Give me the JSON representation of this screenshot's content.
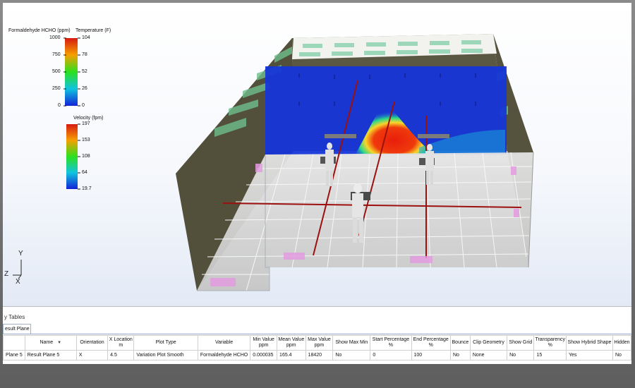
{
  "legends": {
    "formaldehyde": {
      "title": "Formaldehyde HCHO (ppm)",
      "ticks": [
        "1000",
        "750",
        "500",
        "250",
        "0"
      ]
    },
    "temperature": {
      "title": "Temperature (F)",
      "ticks": [
        "104",
        "78",
        "52",
        "26",
        "0"
      ]
    },
    "velocity": {
      "title": "Velocity (fpm)",
      "ticks": [
        "197",
        "153",
        "108",
        "64",
        "19.7"
      ]
    }
  },
  "axes": {
    "y": "Y",
    "z": "Z",
    "x": "X"
  },
  "panel": {
    "title": "y Tables",
    "tab": "esult Plane",
    "columns": [
      {
        "label": "",
        "unit": ""
      },
      {
        "label": "Name",
        "unit": ""
      },
      {
        "label": "Orientation",
        "unit": ""
      },
      {
        "label": "X Location",
        "unit": "m"
      },
      {
        "label": "Plot Type",
        "unit": ""
      },
      {
        "label": "Variable",
        "unit": ""
      },
      {
        "label": "Min Value",
        "unit": "ppm"
      },
      {
        "label": "Mean Value",
        "unit": "ppm"
      },
      {
        "label": "Max Value",
        "unit": "ppm"
      },
      {
        "label": "Show Max Min",
        "unit": ""
      },
      {
        "label": "Start Percentage",
        "unit": "%"
      },
      {
        "label": "End Percentage",
        "unit": "%"
      },
      {
        "label": "Bounce",
        "unit": ""
      },
      {
        "label": "Clip Geometry",
        "unit": ""
      },
      {
        "label": "Show Grid",
        "unit": ""
      },
      {
        "label": "Transparency",
        "unit": "%"
      },
      {
        "label": "Show Hybrid Shape",
        "unit": ""
      },
      {
        "label": "Hidden",
        "unit": ""
      }
    ],
    "rows": [
      [
        "Plane 5",
        "Result Plane 5",
        "X",
        "4.5",
        "Variation Plot Smooth",
        "Formaldehyde HCHO",
        "0.000035",
        "165.4",
        "18420",
        "No",
        "0",
        "100",
        "No",
        "None",
        "No",
        "15",
        "Yes",
        "No"
      ]
    ]
  },
  "colors": {
    "plane_blue": "#1636d8",
    "plume_red": "#e8250e",
    "wall": "#4e4c38",
    "floor": "#d6d6d6",
    "grid_line": "#8fa9c7"
  }
}
